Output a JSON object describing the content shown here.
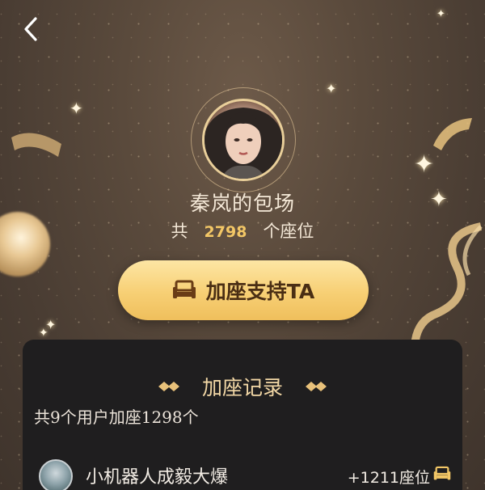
{
  "header": {
    "back_icon": "chevron-left-icon"
  },
  "hero": {
    "title": "秦岚的包场",
    "seat_prefix": "共",
    "seat_count": "2798",
    "seat_suffix": "个座位"
  },
  "action": {
    "add_seat_label": "加座支持TA",
    "icon": "sofa-icon"
  },
  "records": {
    "title": "加座记录",
    "summary": "共9个用户加座1298个",
    "items": [
      {
        "name": "小机器人成毅大爆",
        "seats": "+1211座位"
      }
    ]
  },
  "colors": {
    "accent": "#f3c766",
    "button": "#f7cf74",
    "panel": "#1f1e1f"
  }
}
